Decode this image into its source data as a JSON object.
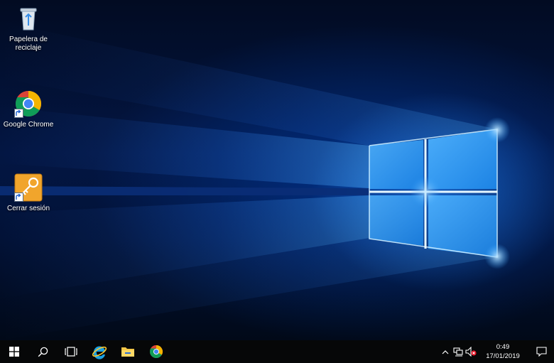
{
  "desktop": {
    "icons": [
      {
        "label": "Papelera de reciclaje",
        "icon": "recycle-bin-icon"
      },
      {
        "label": "Google Chrome",
        "icon": "chrome-icon"
      },
      {
        "label": "Cerrar sesión",
        "icon": "key-icon"
      }
    ]
  },
  "taskbar": {
    "buttons": [
      {
        "icon": "windows-start-icon"
      },
      {
        "icon": "search-icon"
      },
      {
        "icon": "task-view-icon"
      },
      {
        "icon": "internet-explorer-icon"
      },
      {
        "icon": "file-explorer-icon"
      },
      {
        "icon": "chrome-icon"
      }
    ],
    "tray": {
      "icons": [
        "chevron-up-icon",
        "network-icon",
        "volume-muted-icon"
      ],
      "time": "0:49",
      "date": "17/01/2019"
    },
    "notification_icon": "action-center-icon"
  },
  "colors": {
    "taskbar_bg": "#060708",
    "wallpaper_accent": "#3aa6ff"
  }
}
